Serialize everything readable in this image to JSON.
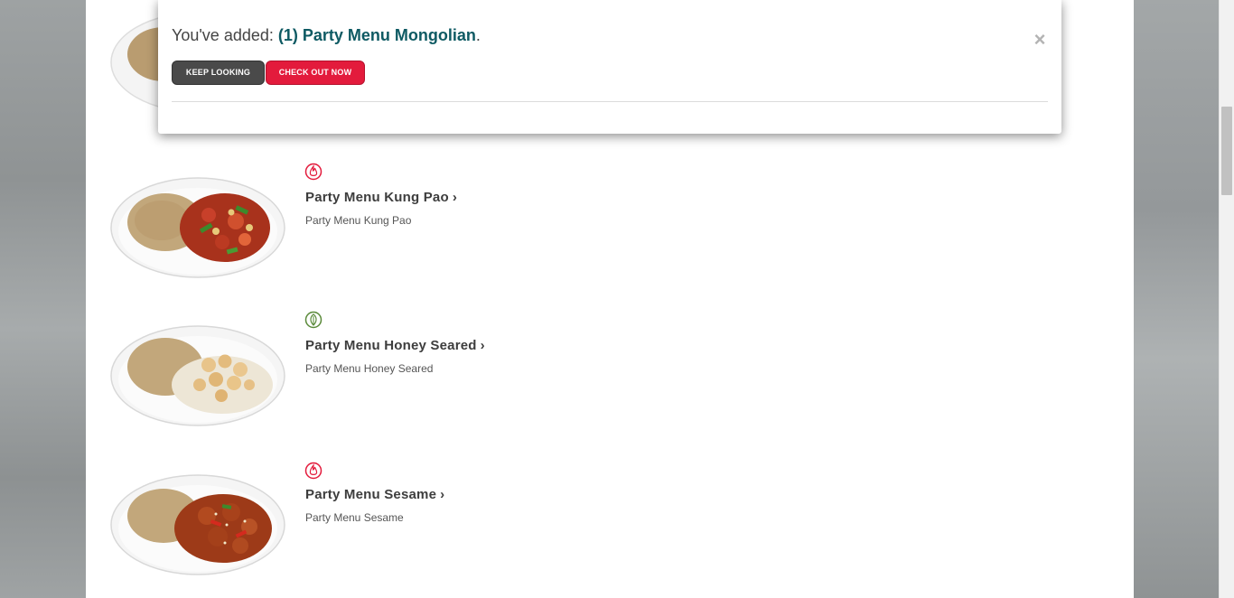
{
  "popup": {
    "prefix": "You've added: ",
    "item_name": "(1) Party Menu Mongolian",
    "suffix": ".",
    "keep_looking_label": "KEEP LOOKING",
    "checkout_label": "CHECK OUT NOW",
    "close_icon": "×"
  },
  "menu_items": [
    {
      "title": "Party Menu Kung Pao",
      "description": "Party Menu Kung Pao",
      "badge": "spicy-icon",
      "chevron": "›"
    },
    {
      "title": "Party Menu Honey Seared",
      "description": "Party Menu Honey Seared",
      "badge": "vegetarian-leaf-icon",
      "chevron": "›"
    },
    {
      "title": "Party Menu Sesame",
      "description": "Party Menu Sesame",
      "badge": "spicy-icon",
      "chevron": "›"
    }
  ],
  "colors": {
    "accent_teal": "#0e5a63",
    "checkout_red": "#e31b3c",
    "keep_gray": "#4a4a4a",
    "spicy_red": "#e31b3c",
    "veg_green": "#5a8a3a"
  }
}
